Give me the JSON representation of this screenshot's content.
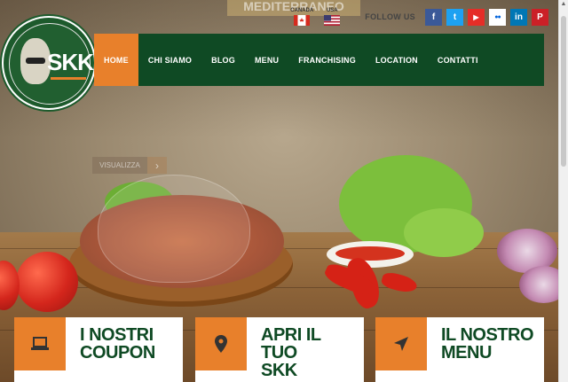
{
  "header": {
    "tagline": "MEDITERRANEO",
    "flags": [
      {
        "label": "CANADA",
        "icon": "canada-flag-icon"
      },
      {
        "label": "USA",
        "icon": "usa-flag-icon"
      }
    ],
    "follow_label": "FOLLOW US",
    "social": [
      {
        "name": "facebook",
        "glyph": "f",
        "color": "#3b5998"
      },
      {
        "name": "twitter",
        "glyph": "t",
        "color": "#1da1f2"
      },
      {
        "name": "youtube",
        "glyph": "▶",
        "color": "#e52d27"
      },
      {
        "name": "flickr",
        "glyph": "●●",
        "color": "#ffffff"
      },
      {
        "name": "linkedin",
        "glyph": "in",
        "color": "#0077b5"
      },
      {
        "name": "pinterest",
        "glyph": "P",
        "color": "#cb2027"
      }
    ]
  },
  "logo": {
    "text": "SKK"
  },
  "nav": {
    "items": [
      {
        "label": "HOME",
        "active": true
      },
      {
        "label": "CHI SIAMO",
        "active": false
      },
      {
        "label": "BLOG",
        "active": false
      },
      {
        "label": "MENU",
        "active": false
      },
      {
        "label": "FRANCHISING",
        "active": false
      },
      {
        "label": "LOCATION",
        "active": false
      },
      {
        "label": "CONTATTI",
        "active": false
      }
    ]
  },
  "hero": {
    "button_label": "VISUALIZZA",
    "arrow": "›"
  },
  "cards": [
    {
      "title_line1": "I NOSTRI",
      "title_line2": "COUPON",
      "icon": "laptop-icon"
    },
    {
      "title_line1": "APRI IL TUO",
      "title_line2": "SKK",
      "icon": "map-pin-icon"
    },
    {
      "title_line1": "IL NOSTRO",
      "title_line2": "MENU",
      "icon": "send-icon"
    }
  ],
  "colors": {
    "brand_green": "#0f4a24",
    "accent_orange": "#e8802b"
  }
}
